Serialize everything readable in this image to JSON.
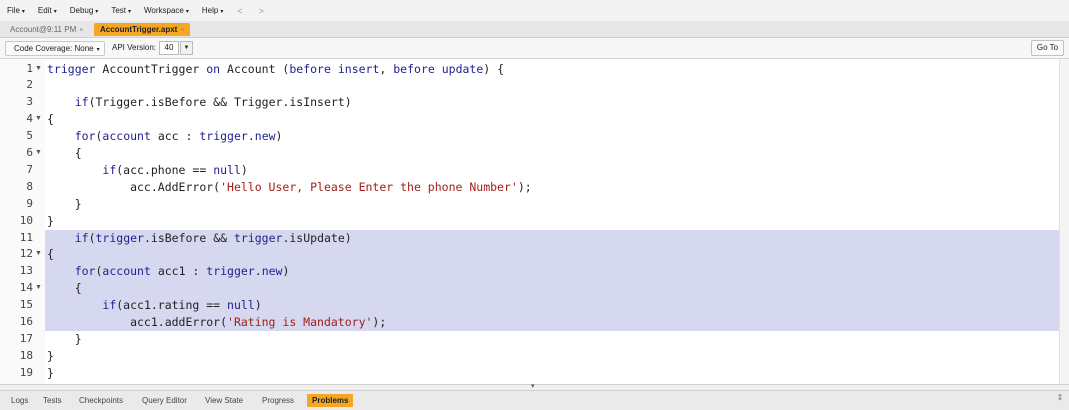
{
  "menubar": {
    "items": [
      "File",
      "Edit",
      "Debug",
      "Test",
      "Workspace",
      "Help"
    ],
    "back": "<",
    "forward": ">"
  },
  "tabs": [
    {
      "label": "Account@9:11 PM",
      "close": "×",
      "active": false
    },
    {
      "label": "AccountTrigger.apxt",
      "close": "×",
      "active": true
    }
  ],
  "toolbar": {
    "code_coverage": "Code Coverage: None",
    "api_label": "API Version:",
    "api_value": "40",
    "goto_label": "Go To"
  },
  "editor": {
    "highlight_lines": [
      11,
      16
    ],
    "fold_lines": [
      1,
      4,
      6,
      12,
      14
    ],
    "lines": [
      {
        "n": "1",
        "t": "trigger AccountTrigger on Account (before insert, before update) {"
      },
      {
        "n": "2",
        "t": ""
      },
      {
        "n": "3",
        "t": "    if(Trigger.isBefore && Trigger.isInsert)"
      },
      {
        "n": "4",
        "t": "{"
      },
      {
        "n": "5",
        "t": "    for(account acc : trigger.new)"
      },
      {
        "n": "6",
        "t": "    {"
      },
      {
        "n": "7",
        "t": "        if(acc.phone == null)"
      },
      {
        "n": "8",
        "t": "            acc.AddError('Hello User, Please Enter the phone Number');"
      },
      {
        "n": "9",
        "t": "    }"
      },
      {
        "n": "10",
        "t": "}"
      },
      {
        "n": "11",
        "t": "    if(trigger.isBefore && trigger.isUpdate)"
      },
      {
        "n": "12",
        "t": "{"
      },
      {
        "n": "13",
        "t": "    for(account acc1 : trigger.new)"
      },
      {
        "n": "14",
        "t": "    {"
      },
      {
        "n": "15",
        "t": "        if(acc1.rating == null)"
      },
      {
        "n": "16",
        "t": "            acc1.addError('Rating is Mandatory');"
      },
      {
        "n": "17",
        "t": "    }"
      },
      {
        "n": "18",
        "t": "}"
      },
      {
        "n": "19",
        "t": "}"
      }
    ]
  },
  "bottom_tabs": [
    {
      "label": "Logs",
      "active": false
    },
    {
      "label": "Tests",
      "active": false
    },
    {
      "label": "Checkpoints",
      "active": false
    },
    {
      "label": "Query Editor",
      "active": false
    },
    {
      "label": "View State",
      "active": false
    },
    {
      "label": "Progress",
      "active": false
    },
    {
      "label": "Problems",
      "active": true
    }
  ]
}
